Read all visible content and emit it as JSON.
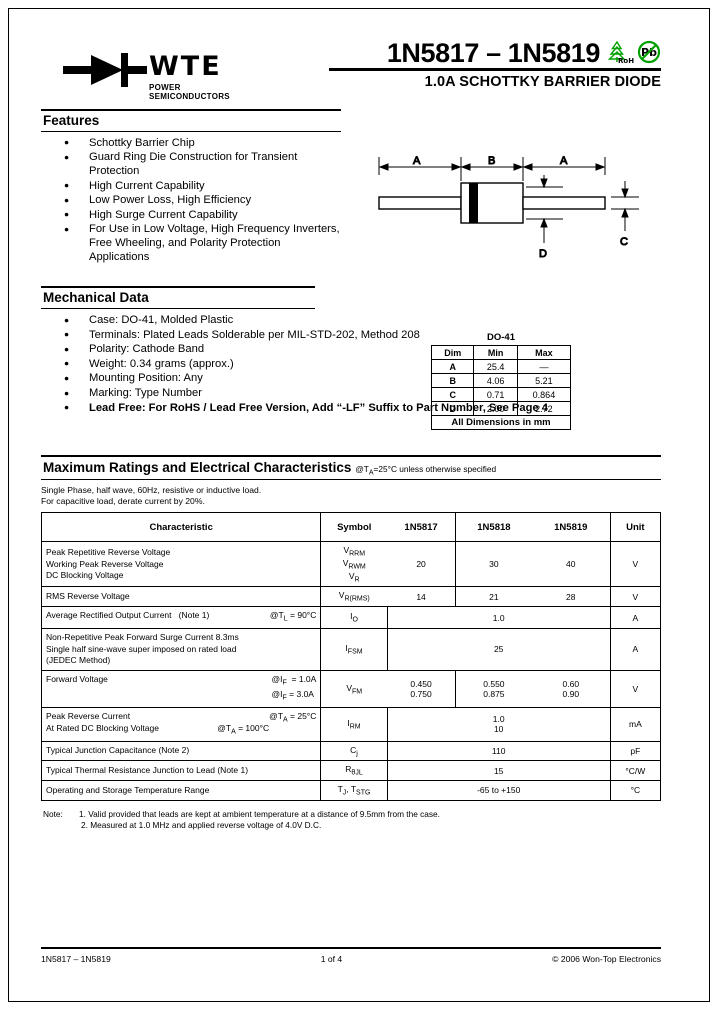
{
  "document": {
    "brand": "WTE",
    "brand_tagline": "POWER SEMICONDUCTORS",
    "title": "1N5817 – 1N5819",
    "subtitle": "1.0A SCHOTTKY BARRIER DIODE",
    "badges": [
      {
        "name": "rohs-icon",
        "label": "RoHS"
      },
      {
        "name": "lead-free-pb-icon",
        "label": "Pb"
      }
    ]
  },
  "features": {
    "heading": "Features",
    "items": [
      "Schottky Barrier Chip",
      "Guard Ring Die Construction for Transient Protection",
      "High Current Capability",
      "Low Power Loss, High Efficiency",
      "High Surge Current Capability",
      "For Use in Low Voltage, High Frequency Inverters, Free Wheeling, and Polarity Protection Applications"
    ]
  },
  "mechanical": {
    "heading": "Mechanical Data",
    "items": [
      {
        "text": "Case: DO-41, Molded Plastic",
        "bold": false
      },
      {
        "text": "Terminals: Plated Leads Solderable per MIL-STD-202, Method 208",
        "bold": false
      },
      {
        "text": "Polarity: Cathode Band",
        "bold": false
      },
      {
        "text": "Weight: 0.34 grams (approx.)",
        "bold": false
      },
      {
        "text": "Mounting Position: Any",
        "bold": false
      },
      {
        "text": "Marking: Type Number",
        "bold": false
      },
      {
        "text": "Lead Free: For RoHS / Lead Free Version, Add “-LF” Suffix to Part Number, See Page 4",
        "bold": true
      }
    ]
  },
  "package_drawing": {
    "labels": [
      "A",
      "B",
      "A",
      "D",
      "C"
    ],
    "case": "DO-41"
  },
  "dim_table": {
    "title": "DO-41",
    "columns": [
      "Dim",
      "Min",
      "Max"
    ],
    "rows": [
      [
        "A",
        "25.4",
        "—"
      ],
      [
        "B",
        "4.06",
        "5.21"
      ],
      [
        "C",
        "0.71",
        "0.864"
      ],
      [
        "D",
        "2.00",
        "2.72"
      ]
    ],
    "footer": "All Dimensions in mm"
  },
  "ratings": {
    "heading": "Maximum Ratings and Electrical Characteristics",
    "condition": "@TA=25°C unless otherwise specified",
    "note_line1": "Single Phase, half wave, 60Hz, resistive or inductive load.",
    "note_line2": "For capacitive load, derate current by 20%.",
    "columns": {
      "characteristic": "Characteristic",
      "symbol": "Symbol",
      "part1": "1N5817",
      "part2": "1N5818",
      "part3": "1N5819",
      "unit": "Unit"
    },
    "rows": [
      {
        "characteristic": "Peak Repetitive Reverse Voltage\nWorking Peak Reverse Voltage\nDC Blocking Voltage",
        "symbol": "VRRM\nVRWM\nVR",
        "merged": false,
        "v1": "20",
        "v2": "30",
        "v3": "40",
        "unit": "V"
      },
      {
        "characteristic": "RMS Reverse Voltage",
        "symbol": "VR(RMS)",
        "merged": false,
        "v1": "14",
        "v2": "21",
        "v3": "28",
        "unit": "V"
      },
      {
        "characteristic": "Average Rectified Output Current",
        "note": "(Note 1)",
        "condition": "@TL = 90°C",
        "symbol": "Io",
        "merged": true,
        "value": "1.0",
        "unit": "A"
      },
      {
        "characteristic": "Non-Repetitive Peak Forward Surge Current 8.3ms\nSingle half sine-wave super imposed on rated load\n(JEDEC Method)",
        "symbol": "IFSM",
        "merged": true,
        "value": "25",
        "unit": "A"
      },
      {
        "characteristic": "Forward Voltage",
        "condition": "@IF  = 1.0A\n@IF = 3.0A",
        "symbol": "VFM",
        "merged": false,
        "v1": "0.450\n0.750",
        "v2": "0.550\n0.875",
        "v3": "0.60\n0.90",
        "unit": "V"
      },
      {
        "characteristic": "Peak Reverse Current\nAt Rated DC Blocking Voltage",
        "condition": "@TA = 25°C\n@TA = 100°C",
        "symbol": "IRM",
        "merged": true,
        "value": "1.0\n10",
        "unit": "mA"
      },
      {
        "characteristic": "Typical Junction Capacitance (Note 2)",
        "symbol": "Cj",
        "merged": true,
        "value": "110",
        "unit": "pF"
      },
      {
        "characteristic": "Typical Thermal Resistance Junction to Lead (Note 1)",
        "symbol": "RθJL",
        "merged": true,
        "value": "15",
        "unit": "°C/W"
      },
      {
        "characteristic": "Operating and Storage Temperature Range",
        "symbol": "Tj, Tstg",
        "merged": true,
        "value": "-65 to +150",
        "unit": "°C"
      }
    ],
    "notes_label": "Note:",
    "notes": [
      "1. Valid provided that leads are kept at ambient temperature at a distance of 9.5mm from the case.",
      "2. Measured at 1.0 MHz and applied reverse voltage of 4.0V D.C."
    ]
  },
  "footer": {
    "part": "1N5817 – 1N5819",
    "page": "1 of 4",
    "copyright": "© 2006 Won-Top Electronics"
  }
}
